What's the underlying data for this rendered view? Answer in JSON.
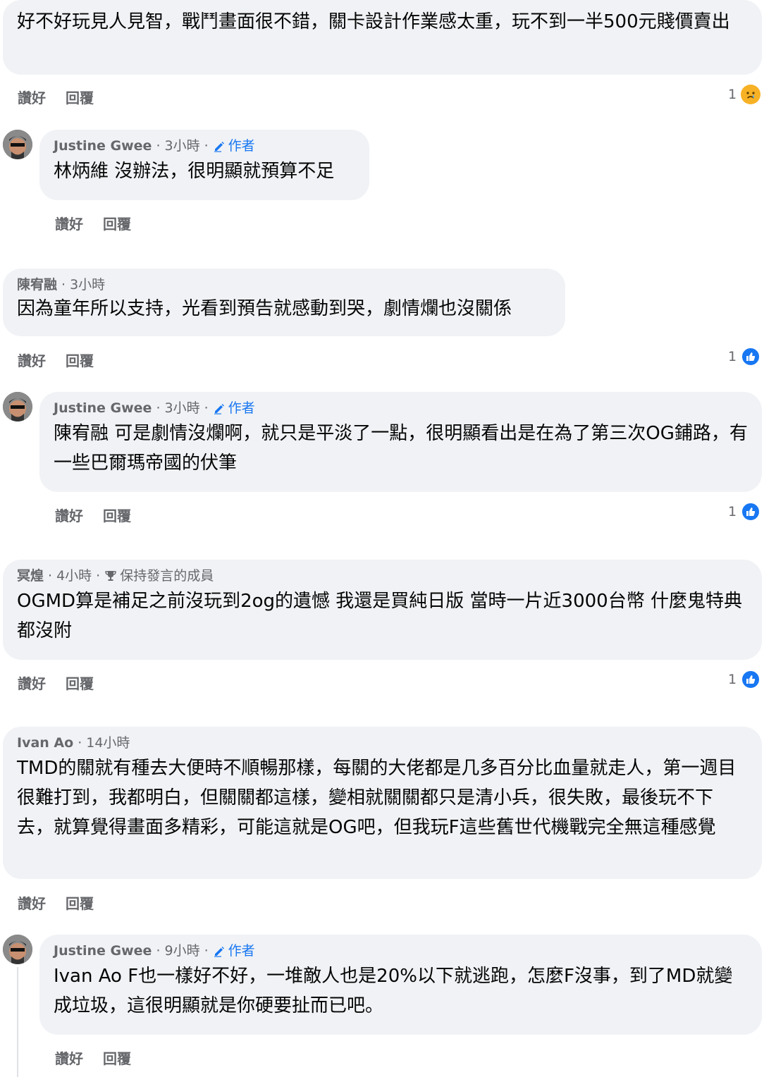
{
  "actions": {
    "like": "讚好",
    "reply": "回覆"
  },
  "comments": [
    {
      "text": "好不好玩見人見智，戰鬥畫面很不錯，關卡設計作業感太重，玩不到一半500元賤價賣出",
      "reaction_count": "1",
      "reaction_type": "sad"
    },
    {
      "author": "Justine Gwee",
      "time": "3小時",
      "badge": "作者",
      "text": "林炳維 沒辦法，很明顯就預算不足"
    },
    {
      "author": "陳宥融",
      "time": "3小時",
      "text": "因為童年所以支持，光看到預告就感動到哭，劇情爛也沒關係",
      "reaction_count": "1",
      "reaction_type": "like"
    },
    {
      "author": "Justine Gwee",
      "time": "3小時",
      "badge": "作者",
      "text": "陳宥融 可是劇情沒爛啊，就只是平淡了一點，很明顯看出是在為了第三次OG鋪路，有一些巴爾瑪帝國的伏筆",
      "reaction_count": "1",
      "reaction_type": "like"
    },
    {
      "author": "冥煌",
      "time": "4小時",
      "badge": "保持發言的成員",
      "text": "OGMD算是補足之前沒玩到2og的遺憾 我還是買純日版 當時一片近3000台幣 什麼鬼特典都沒附",
      "reaction_count": "1",
      "reaction_type": "like"
    },
    {
      "author": "Ivan Ao",
      "time": "14小時",
      "text": "TMD的關就有種去大便時不順暢那樣，每關的大佬都是几多百分比血量就走人，第一週目很難打到，我都明白，但關關都這樣，變相就關關都只是清小兵，很失敗，最後玩不下去，就算覺得畫面多精彩，可能這就是OG吧，但我玩F這些舊世代機戰完全無這種感覺"
    },
    {
      "author": "Justine Gwee",
      "time": "9小時",
      "badge": "作者",
      "text": "Ivan Ao F也一樣好不好，一堆敵人也是20%以下就逃跑，怎麼F沒事，到了MD就變成垃圾，這很明顯就是你硬要扯而已吧。"
    }
  ],
  "colors": {
    "bubble": "#f0f2f5",
    "meta": "#65676b",
    "accent": "#1877f2",
    "text": "#050505"
  }
}
